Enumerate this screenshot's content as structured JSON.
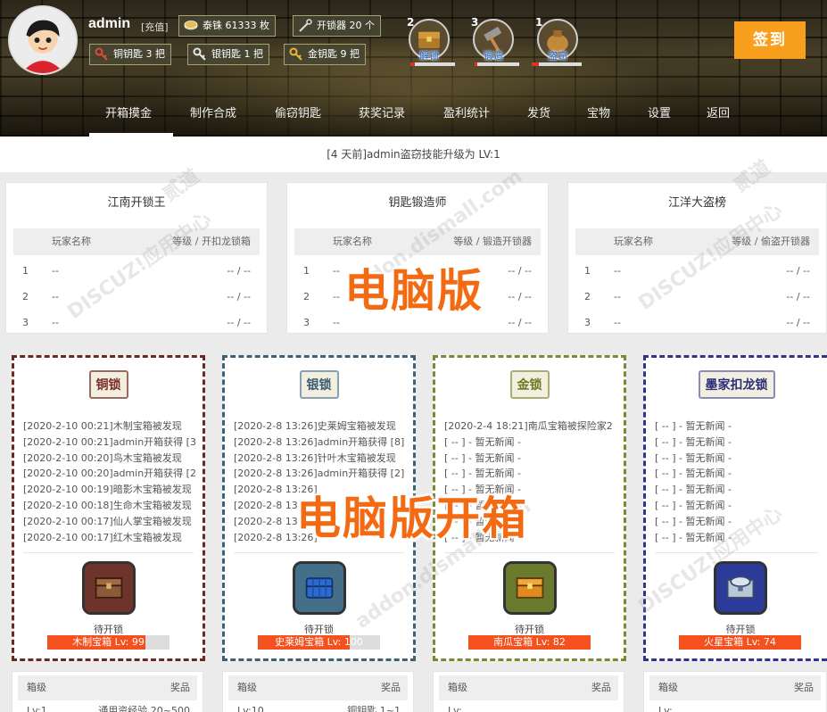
{
  "colors": {
    "accent": "#f8a01e",
    "nav_text": "#f0f0f0",
    "bar_fill": "#f4511e",
    "overlay_text": "#f46a12",
    "bronze_border": "#6a2a22",
    "silver_border": "#3d6278",
    "gold_border": "#7a8a32",
    "mojia_border": "#33338a"
  },
  "header": {
    "username": "admin",
    "recharge_label": "[充值]",
    "chips": [
      {
        "icon": "coin-icon",
        "label": "泰铢 61333 枚"
      },
      {
        "icon": "lockpick-icon",
        "label": "开锁器 20 个"
      },
      {
        "icon": "copper-key-icon",
        "label": "铜钥匙 3 把"
      },
      {
        "icon": "silver-key-icon",
        "label": "银钥匙 1 把"
      },
      {
        "icon": "gold-key-icon",
        "label": "金钥匙 9 把"
      }
    ],
    "tools": [
      {
        "level": "2",
        "label": "解锁",
        "progress": 0.1
      },
      {
        "level": "3",
        "label": "锻造",
        "progress": 0.05
      },
      {
        "level": "1",
        "label": "盗窃",
        "progress": 0.15
      }
    ],
    "signin_label": "签到"
  },
  "nav": {
    "items": [
      "开箱摸金",
      "制作合成",
      "偷窃钥匙",
      "获奖记录",
      "盈利统计",
      "发货",
      "宝物",
      "设置",
      "返回"
    ],
    "active": "开箱摸金"
  },
  "notice": "[4 天前]admin盗窃技能升级为 LV:1",
  "rankings": [
    {
      "title": "江南开锁王",
      "col1": "玩家名称",
      "col2": "等级 / 开扣龙锁箱",
      "rows": [
        {
          "n": "1",
          "p": "--",
          "v": "-- / --"
        },
        {
          "n": "2",
          "p": "--",
          "v": "-- / --"
        },
        {
          "n": "3",
          "p": "--",
          "v": "-- / --"
        }
      ]
    },
    {
      "title": "钥匙锻造师",
      "col1": "玩家名称",
      "col2": "等级 / 锻造开锁器",
      "rows": [
        {
          "n": "1",
          "p": "--",
          "v": "-- / --"
        },
        {
          "n": "2",
          "p": "--",
          "v": "-- / --"
        },
        {
          "n": "3",
          "p": "--",
          "v": "-- / --"
        }
      ]
    },
    {
      "title": "江洋大盗榜",
      "col1": "玩家名称",
      "col2": "等级 / 偷盗开锁器",
      "rows": [
        {
          "n": "1",
          "p": "--",
          "v": "-- / --"
        },
        {
          "n": "2",
          "p": "--",
          "v": "-- / --"
        },
        {
          "n": "3",
          "p": "--",
          "v": "-- / --"
        }
      ]
    }
  ],
  "locks": [
    {
      "title": "铜锁",
      "news": [
        "[2020-2-10 00:21]木制宝箱被发现",
        "[2020-2-10 00:21]admin开箱获得 [3",
        "[2020-2-10 00:20]鸟木宝箱被发现",
        "[2020-2-10 00:20]admin开箱获得 [2",
        "[2020-2-10 00:19]暗影木宝箱被发现",
        "[2020-2-10 00:18]生命木宝箱被发现",
        "[2020-2-10 00:17]仙人掌宝箱被发现",
        "[2020-2-10 00:17]红木宝箱被发现"
      ],
      "pending": "待开锁",
      "chest": "木制宝箱 Lv: 99",
      "progress": 0.8
    },
    {
      "title": "银锁",
      "news": [
        "[2020-2-8 13:26]史莱姆宝箱被发现",
        "[2020-2-8 13:26]admin开箱获得 [8]",
        "[2020-2-8 13:26]针叶木宝箱被发现",
        "[2020-2-8 13:26]admin开箱获得 [2]",
        "[2020-2-8 13:26]",
        "[2020-2-8 13",
        "[2020-2-8 13",
        "[2020-2-8 13:26]"
      ],
      "pending": "待开锁",
      "chest": "史莱姆宝箱 Lv: 100",
      "progress": 0.75
    },
    {
      "title": "金锁",
      "news": [
        "[2020-2-4 18:21]南瓜宝箱被探险家2",
        "[ -- ] - 暂无新闻 -",
        "[ -- ] - 暂无新闻 -",
        "[ -- ] - 暂无新闻 -",
        "[ -- ] - 暂无新闻 -",
        "[ -- ] - 暂无新闻 -",
        "[ -- ] - 暂无新闻 -",
        "[ -- ] - 暂无新闻 -"
      ],
      "pending": "待开锁",
      "chest": "南瓜宝箱 Lv: 82",
      "progress": 1.0
    },
    {
      "title": "墨家扣龙锁",
      "news": [
        "[ -- ] - 暂无新闻 -",
        "[ -- ] - 暂无新闻 -",
        "[ -- ] - 暂无新闻 -",
        "[ -- ] - 暂无新闻 -",
        "[ -- ] - 暂无新闻 -",
        "[ -- ] - 暂无新闻 -",
        "[ -- ] - 暂无新闻 -",
        "[ -- ] - 暂无新闻 -"
      ],
      "pending": "待开锁",
      "chest": "火星宝箱 Lv: 74",
      "progress": 1.0
    }
  ],
  "bottom_tables": [
    {
      "col1": "箱级",
      "col2": "奖品",
      "row_a": "Lv:1",
      "row_b": "通用资经验 20~500"
    },
    {
      "col1": "箱级",
      "col2": "奖品",
      "row_a": "Lv:10",
      "row_b": "铜钥匙 1~1"
    },
    {
      "col1": "箱级",
      "col2": "奖品",
      "row_a": "Lv:",
      "row_b": ""
    },
    {
      "col1": "箱级",
      "col2": "奖品",
      "row_a": "Lv:",
      "row_b": ""
    }
  ],
  "overlay_labels": {
    "pc_version": "电脑版",
    "pc_open_box": "电脑版开箱"
  },
  "watermark": {
    "brand": "DISCUZ!应用中心",
    "domain": "addon.dismall.com",
    "author": "贰道"
  }
}
